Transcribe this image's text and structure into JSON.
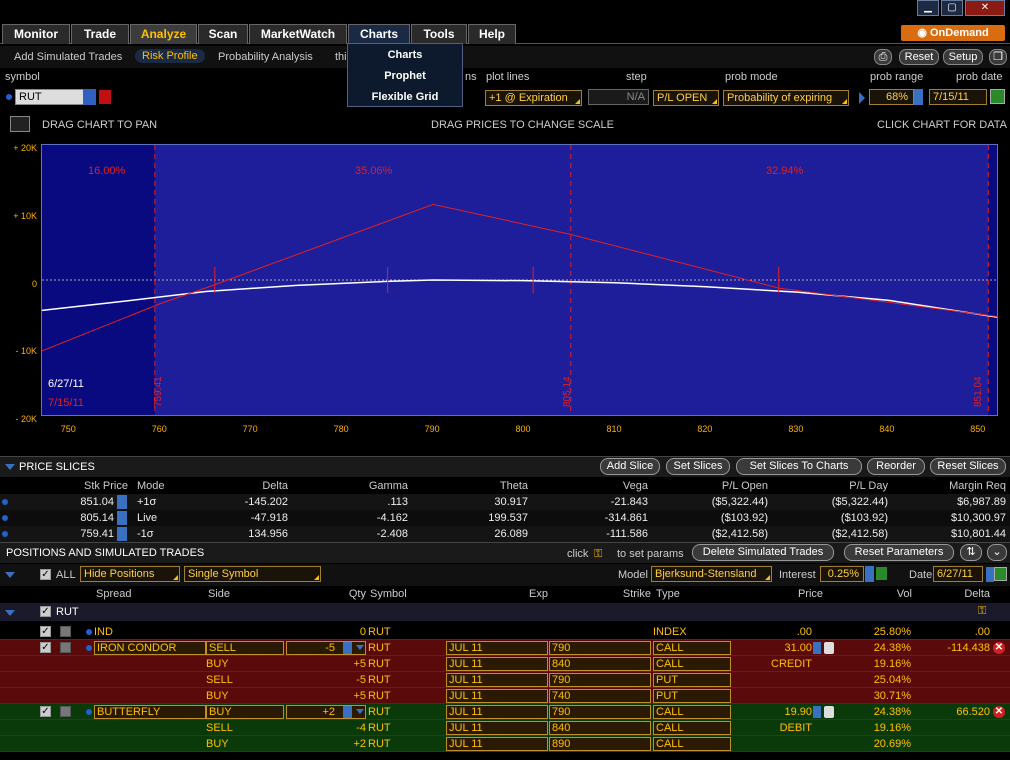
{
  "window": {
    "min": "▁",
    "restore": "▢",
    "close": "✕"
  },
  "nav": {
    "tabs": [
      "Monitor",
      "Trade",
      "Analyze",
      "Scan",
      "MarketWatch",
      "Charts",
      "Tools",
      "Help"
    ],
    "active": "Analyze",
    "ondemand": "OnDemand"
  },
  "charts_menu": [
    "Charts",
    "Prophet",
    "Flexible Grid"
  ],
  "subnav": {
    "tabs": [
      "Add Simulated Trades",
      "Risk Profile",
      "Probability Analysis",
      "thi"
    ],
    "active": "Risk Profile",
    "reset": "Reset",
    "setup": "Setup"
  },
  "params": {
    "symbol_label": "symbol",
    "symbol": "RUT",
    "ns_label": "ns",
    "plot_lines_label": "plot lines",
    "plot_lines": "+1 @ Expiration",
    "step_label": "step",
    "step": "N/A",
    "pl_open": "P/L OPEN",
    "prob_mode_label": "prob mode",
    "prob_mode": "Probability of expiring",
    "prob_range_label": "prob range",
    "prob_range": "68%",
    "prob_date_label": "prob date",
    "prob_date": "7/15/11"
  },
  "chart_hints": {
    "left": "DRAG CHART TO PAN",
    "mid": "DRAG PRICES TO CHANGE SCALE",
    "right": "CLICK CHART FOR DATA"
  },
  "chart_data": {
    "type": "line",
    "x_range": [
      747,
      852
    ],
    "y_range": [
      -20000,
      20000
    ],
    "x_ticks": [
      "750",
      "760",
      "770",
      "780",
      "790",
      "800",
      "810",
      "820",
      "830",
      "840",
      "850"
    ],
    "y_ticks": [
      "+ 20K",
      "+ 10K",
      "0",
      "- 10K",
      "- 20K"
    ],
    "probabilities": [
      "16.00%",
      "35.06%",
      "32.94%"
    ],
    "slice_prices": [
      "759.41",
      "805.14",
      "851.04"
    ],
    "dates": [
      "6/27/11",
      "7/15/11"
    ],
    "series": [
      {
        "name": "7/15/11",
        "x": [
          747,
          760,
          766,
          790,
          805,
          828,
          852
        ],
        "y": [
          -10500,
          -3500,
          -700,
          11200,
          6800,
          -1200,
          -5400
        ]
      },
      {
        "name": "6/27/11",
        "x": [
          747,
          755,
          765,
          775,
          785,
          790,
          800,
          810,
          820,
          830,
          840,
          852
        ],
        "y": [
          -4500,
          -3300,
          -1700,
          -800,
          -200,
          0,
          -100,
          -400,
          -1000,
          -1800,
          -3000,
          -5500
        ]
      }
    ]
  },
  "price_slices": {
    "title": "PRICE SLICES",
    "buttons": [
      "Add Slice",
      "Set Slices",
      "Set Slices To Charts",
      "Reorder",
      "Reset Slices"
    ],
    "headers": [
      "Stk Price",
      "Mode",
      "Delta",
      "Gamma",
      "Theta",
      "Vega",
      "P/L Open",
      "P/L Day",
      "Margin Req"
    ],
    "rows": [
      [
        "851.04",
        "+1σ",
        "-145.202",
        ".113",
        "30.917",
        "-21.843",
        "($5,322.44)",
        "($5,322.44)",
        "$6,987.89"
      ],
      [
        "805.14",
        "Live",
        "-47.918",
        "-4.162",
        "199.537",
        "-314.861",
        "($103.92)",
        "($103.92)",
        "$10,300.97"
      ],
      [
        "759.41",
        "-1σ",
        "134.956",
        "-2.408",
        "26.089",
        "-111.586",
        "($2,412.58)",
        "($2,412.58)",
        "$10,801.44"
      ]
    ]
  },
  "positions": {
    "title": "POSITIONS AND SIMULATED TRADES",
    "click_hint": "click",
    "set_params": "to set params",
    "delete_btn": "Delete Simulated Trades",
    "reset_params_btn": "Reset Parameters",
    "all_label": "ALL",
    "hide_positions": "Hide Positions",
    "single_symbol": "Single Symbol",
    "model_label": "Model",
    "model": "Bjerksund-Stensland",
    "interest_label": "Interest",
    "interest": "0.25%",
    "date_label": "Date",
    "date": "6/27/11",
    "headers": [
      "Spread",
      "Side",
      "Qty",
      "Symbol",
      "Exp",
      "Strike",
      "Type",
      "Price",
      "Vol",
      "Delta"
    ],
    "group": "RUT",
    "rows": [
      {
        "spread": "IND",
        "side": "",
        "qty": "0",
        "symbol": "RUT",
        "exp": "",
        "strike": "",
        "type": "INDEX",
        "price": ".00",
        "vol": "25.80%",
        "delta": ".00",
        "bg": "#000"
      },
      {
        "spread": "IRON CONDOR",
        "side": "SELL",
        "qty": "-5",
        "symbol": "RUT",
        "exp": "JUL 11",
        "strike": "790",
        "type": "CALL",
        "price": "31.00",
        "vol": "24.38%",
        "delta": "-114.438",
        "bg": "#5a0a0a"
      },
      {
        "spread": "",
        "side": "BUY",
        "qty": "+5",
        "symbol": "RUT",
        "exp": "JUL 11",
        "strike": "840",
        "type": "CALL",
        "price": "CREDIT",
        "vol": "19.16%",
        "delta": "",
        "bg": "#5a0a0a"
      },
      {
        "spread": "",
        "side": "SELL",
        "qty": "-5",
        "symbol": "RUT",
        "exp": "JUL 11",
        "strike": "790",
        "type": "PUT",
        "price": "",
        "vol": "25.04%",
        "delta": "",
        "bg": "#5a0a0a"
      },
      {
        "spread": "",
        "side": "BUY",
        "qty": "+5",
        "symbol": "RUT",
        "exp": "JUL 11",
        "strike": "740",
        "type": "PUT",
        "price": "",
        "vol": "30.71%",
        "delta": "",
        "bg": "#5a0a0a"
      },
      {
        "spread": "BUTTERFLY",
        "side": "BUY",
        "qty": "+2",
        "symbol": "RUT",
        "exp": "JUL 11",
        "strike": "790",
        "type": "CALL",
        "price": "19.90",
        "vol": "24.38%",
        "delta": "66.520",
        "bg": "#0a3a0a"
      },
      {
        "spread": "",
        "side": "SELL",
        "qty": "-4",
        "symbol": "RUT",
        "exp": "JUL 11",
        "strike": "840",
        "type": "CALL",
        "price": "DEBIT",
        "vol": "19.16%",
        "delta": "",
        "bg": "#0a3a0a"
      },
      {
        "spread": "",
        "side": "BUY",
        "qty": "+2",
        "symbol": "RUT",
        "exp": "JUL 11",
        "strike": "890",
        "type": "CALL",
        "price": "",
        "vol": "20.69%",
        "delta": "",
        "bg": "#0a3a0a"
      }
    ]
  },
  "colors": {
    "accent": "#ffc000",
    "plot_bg": "#0a0a80",
    "expiration_line": "#e02020",
    "today_line": "#ffffff"
  }
}
